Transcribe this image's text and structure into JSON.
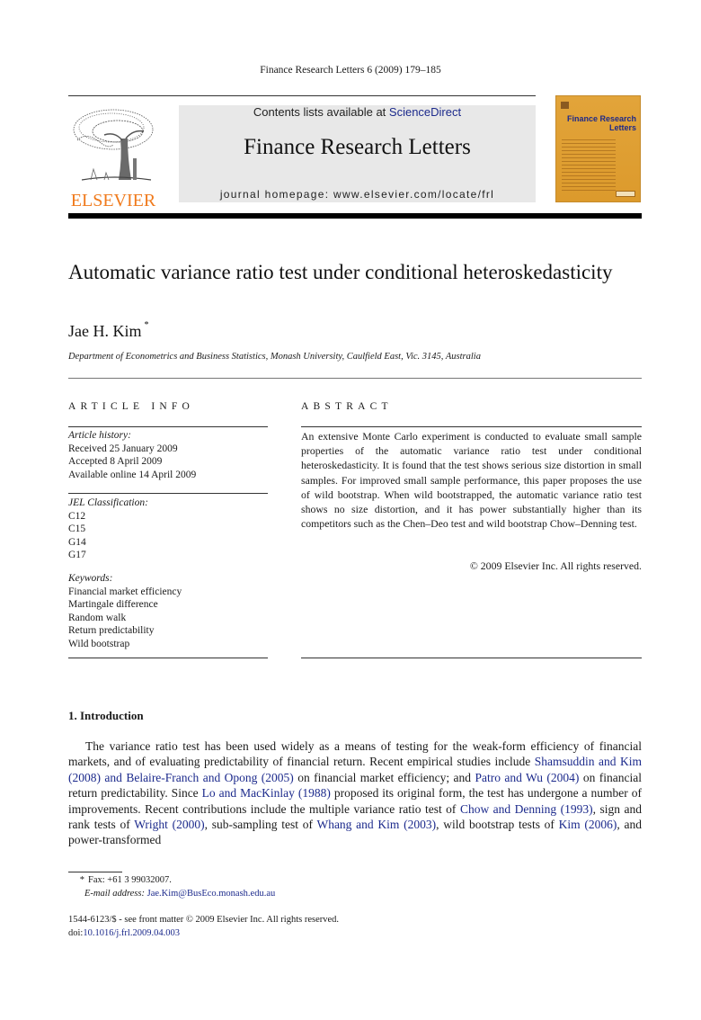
{
  "journal_citation": "Finance Research Letters 6 (2009) 179–185",
  "header": {
    "publisher_logo_text": "ELSEVIER",
    "contents_prefix": "Contents lists available at ",
    "contents_link": "ScienceDirect",
    "journal_title": "Finance Research Letters",
    "homepage": "journal homepage: www.elsevier.com/locate/frl",
    "cover_title": "Finance Research Letters",
    "colors": {
      "elsevier_orange": "#f07a1c",
      "link_blue": "#1c2a8c",
      "cover_gold": "#e0a035"
    }
  },
  "article": {
    "title": "Automatic variance ratio test under conditional heteroskedasticity",
    "author": "Jae H. Kim",
    "author_mark": "*",
    "affiliation": "Department of Econometrics and Business Statistics, Monash University, Caulfield East, Vic. 3145, Australia"
  },
  "article_info": {
    "heading": "ARTICLE INFO",
    "history_label": "Article history:",
    "history": [
      "Received 25 January 2009",
      "Accepted 8 April 2009",
      "Available online 14 April 2009"
    ],
    "jel_label": "JEL Classification:",
    "jel": [
      "C12",
      "C15",
      "G14",
      "G17"
    ],
    "keywords_label": "Keywords:",
    "keywords": [
      "Financial market efficiency",
      "Martingale difference",
      "Random walk",
      "Return predictability",
      "Wild bootstrap"
    ]
  },
  "abstract": {
    "heading": "ABSTRACT",
    "text": "An extensive Monte Carlo experiment is conducted to evaluate small sample properties of the automatic variance ratio test under conditional heteroskedasticity. It is found that the test shows serious size distortion in small samples. For improved small sample performance, this paper proposes the use of wild bootstrap. When wild bootstrapped, the automatic variance ratio test shows no size distortion, and it has power substantially higher than its competitors such as the Chen–Deo test and wild bootstrap Chow–Denning test.",
    "copyright": "© 2009 Elsevier Inc. All rights reserved."
  },
  "introduction": {
    "heading": "1.  Introduction",
    "segments": [
      {
        "t": "The variance ratio test has been used widely as a means of testing for the weak-form efficiency of financial markets, and of evaluating predictability of financial return. Recent empirical studies include "
      },
      {
        "t": "Shamsuddin and Kim (2008) and Belaire-Franch and Opong (2005)",
        "link": true
      },
      {
        "t": " on financial market efficiency; and "
      },
      {
        "t": "Patro and Wu (2004)",
        "link": true
      },
      {
        "t": " on financial return predictability. Since "
      },
      {
        "t": "Lo and MacKinlay (1988)",
        "link": true
      },
      {
        "t": " proposed its original form, the test has undergone a number of improvements. Recent contributions include the multiple variance ratio test of "
      },
      {
        "t": "Chow and Denning (1993)",
        "link": true
      },
      {
        "t": ", sign and rank tests of "
      },
      {
        "t": "Wright (2000)",
        "link": true
      },
      {
        "t": ", sub-sampling test of "
      },
      {
        "t": "Whang and Kim (2003)",
        "link": true
      },
      {
        "t": ", wild bootstrap tests of "
      },
      {
        "t": "Kim (2006)",
        "link": true
      },
      {
        "t": ", and power-transformed"
      }
    ]
  },
  "footnotes": {
    "star": "*",
    "fax": "Fax: +61 3 99032007.",
    "email_label": "E-mail address: ",
    "email": "Jae.Kim@BusEco.monash.edu.au"
  },
  "front_matter": {
    "issn_line": "1544-6123/$ - see front matter © 2009 Elsevier Inc. All rights reserved.",
    "doi_prefix": "doi:",
    "doi": "10.1016/j.frl.2009.04.003"
  }
}
